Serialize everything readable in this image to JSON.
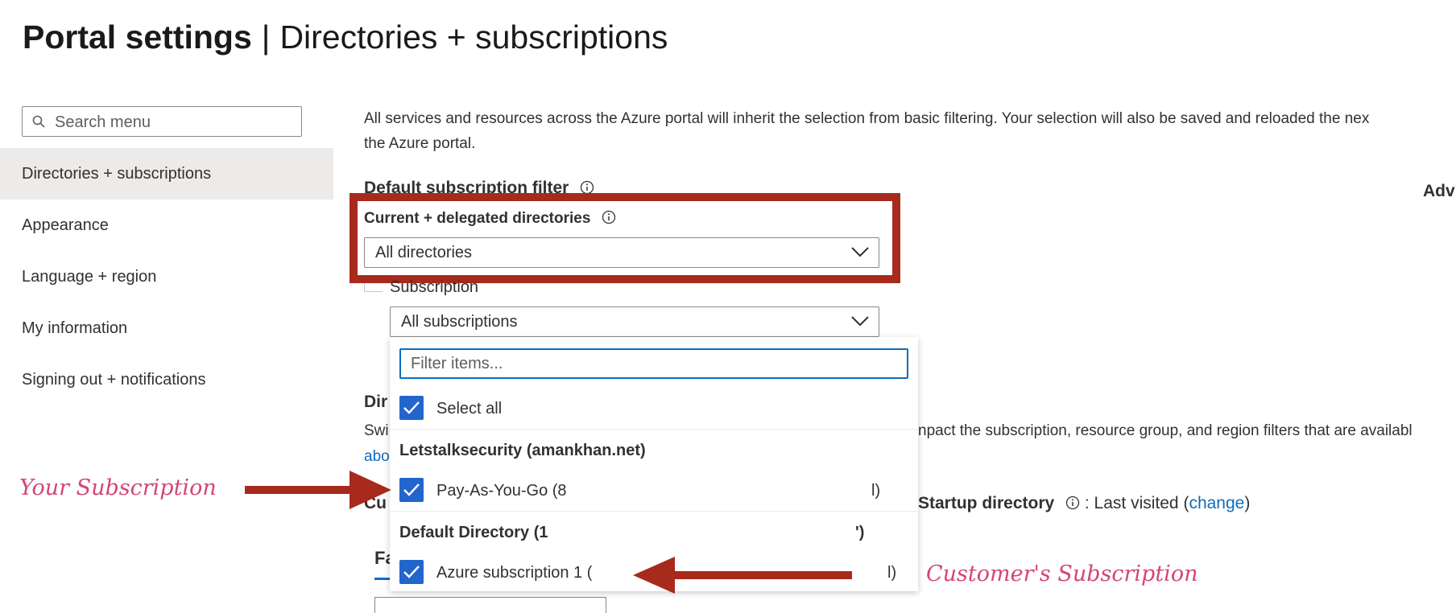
{
  "header": {
    "title_strong": "Portal settings",
    "separator": "|",
    "title_rest": "Directories + subscriptions"
  },
  "sidebar": {
    "search_placeholder": "Search menu",
    "items": [
      {
        "label": "Directories + subscriptions",
        "active": true
      },
      {
        "label": "Appearance"
      },
      {
        "label": "Language + region"
      },
      {
        "label": "My information"
      },
      {
        "label": "Signing out + notifications"
      }
    ]
  },
  "main": {
    "intro_text": "All services and resources across the Azure portal will inherit the selection from basic filtering. Your selection will also be saved and reloaded the nex",
    "intro_text_line2": "the Azure portal.",
    "default_filter_title": "Default subscription filter",
    "advanced_label_partial": "Adv",
    "directories_label": "Current + delegated directories",
    "directories_value": "All directories",
    "subscription_label": "Subscription",
    "subscription_value": "All subscriptions",
    "dir_section_partial": "Dir",
    "dir_desc_left_partial": "Swi",
    "dir_desc_right_partial": "npact the subscription, resource group, and region filters that are availabl",
    "about_link_partial": "abo",
    "current_partial": "Cu",
    "startup_label": "Startup directory",
    "startup_value_prefix": ": Last visited (",
    "startup_change_link": "change",
    "startup_value_suffix": ")",
    "favorites_tab_partial": "Fa"
  },
  "popup": {
    "filter_placeholder": "Filter items...",
    "select_all_label": "Select all",
    "groups": [
      {
        "header": "Letstalksecurity (amankhan.net)",
        "item_label_start": "Pay-As-You-Go (8",
        "item_label_end": "l)"
      },
      {
        "header_start": "Default Directory (1",
        "header_end": "')",
        "item_label_start": "Azure subscription 1 (",
        "item_label_end": "l)"
      }
    ]
  },
  "annotations": {
    "your_subscription": "Your Subscription",
    "customer_subscription": "Customer's Subscription"
  },
  "colors": {
    "accent": "#0f6cbd",
    "checkbox": "#2266cc",
    "annotation_box": "#a72a1d",
    "annotation_text": "#d4457a",
    "nav_active_bg": "#edebe9"
  }
}
